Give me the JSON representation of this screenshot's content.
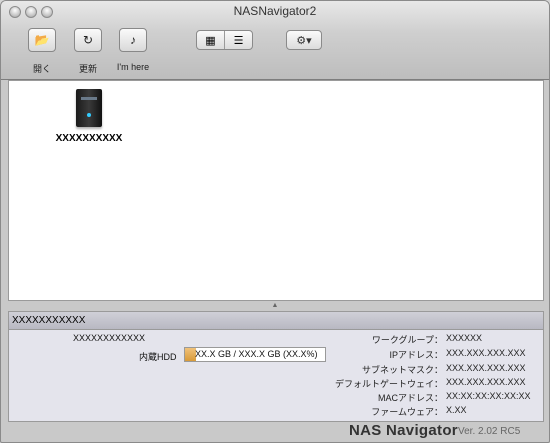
{
  "window": {
    "title": "NASNavigator2"
  },
  "toolbar": {
    "open_label": "開く",
    "refresh_label": "更新",
    "imhere_label": "I'm here",
    "icon_view": "icon-view-icon",
    "list_view": "list-view-icon",
    "action_menu": "gear-icon"
  },
  "device": {
    "name": "XXXXXXXXXX"
  },
  "details": {
    "header": "XXXXXXXXXXX",
    "device_name": "XXXXXXXXXXXX",
    "hdd_label": "内蔵HDD",
    "hdd_text": "XX.X GB / XXX.X GB (XX.X%)",
    "hdd_usage_fraction": 0.08,
    "workgroup_label": "ワークグループ：",
    "workgroup_value": "XXXXXX",
    "ip_label": "IPアドレス：",
    "ip_value": "XXX.XXX.XXX.XXX",
    "subnet_label": "サブネットマスク：",
    "subnet_value": "XXX.XXX.XXX.XXX",
    "gateway_label": "デフォルトゲートウェイ：",
    "gateway_value": "XXX.XXX.XXX.XXX",
    "mac_label": "MACアドレス：",
    "mac_value": "XX:XX:XX:XX:XX:XX",
    "firmware_label": "ファームウェア：",
    "firmware_value": "X.XX"
  },
  "footer": {
    "brand": "NAS Navigator",
    "version": "Ver. 2.02 RC5"
  }
}
